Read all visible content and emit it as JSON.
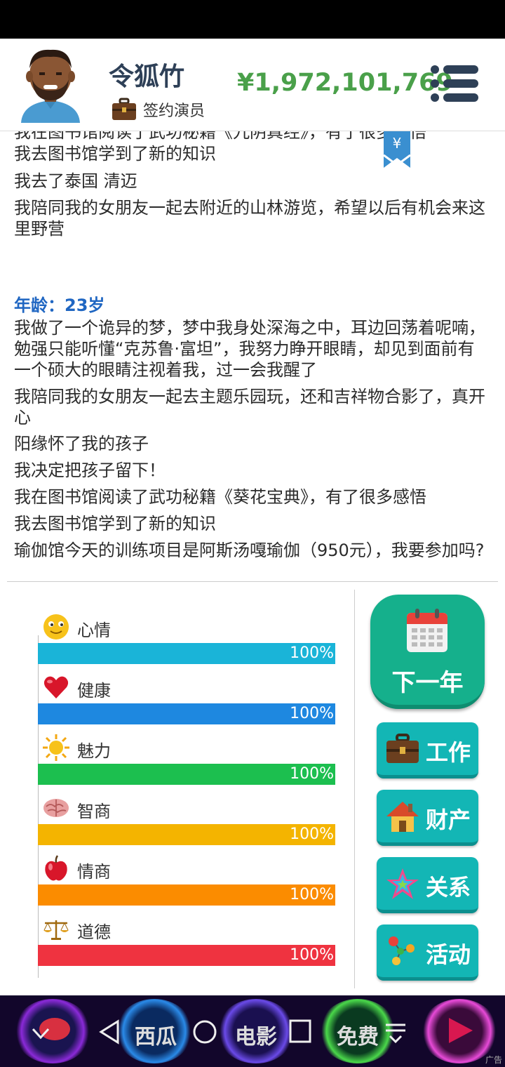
{
  "header": {
    "player_name": "令狐竹",
    "job": "签约演员",
    "money": "¥1,972,101,769"
  },
  "log": {
    "entries_before": [
      "我去图书馆学到了新的知识",
      "我去了泰国 清迈",
      "我陪同我的女朋友一起去附近的山林游览，希望以后有机会来这里野营"
    ],
    "age_heading": "年龄：23岁",
    "entries_after": [
      "我做了一个诡异的梦，梦中我身处深海之中，耳边回荡着呢喃，勉强只能听懂“克苏鲁·富坦”，我努力睁开眼睛，却见到面前有一个硕大的眼睛注视着我，过一会我醒了",
      "我陪同我的女朋友一起去主题乐园玩，还和吉祥物合影了，真开心",
      "阳缘怀了我的孩子",
      "我决定把孩子留下！",
      "我在图书馆阅读了武功秘籍《葵花宝典》，有了很多感悟",
      "我去图书馆学到了新的知识",
      "瑜伽馆今天的训练项目是阿斯汤嘎瑜伽（950元），我要参加吗?"
    ]
  },
  "stats": [
    {
      "label": "心情",
      "value": "100%",
      "fraction": 1.0,
      "color": "#1ab4d8",
      "icon": "smiley-icon"
    },
    {
      "label": "健康",
      "value": "100%",
      "fraction": 1.0,
      "color": "#1e88e0",
      "icon": "heart-icon"
    },
    {
      "label": "魅力",
      "value": "100%",
      "fraction": 1.0,
      "color": "#1cbf4f",
      "icon": "sun-icon"
    },
    {
      "label": "智商",
      "value": "100%",
      "fraction": 1.0,
      "color": "#f4b400",
      "icon": "brain-icon"
    },
    {
      "label": "情商",
      "value": "100%",
      "fraction": 1.0,
      "color": "#fb8c00",
      "icon": "apple-icon"
    },
    {
      "label": "道德",
      "value": "100%",
      "fraction": 1.0,
      "color": "#ef3340",
      "icon": "scales-icon"
    }
  ],
  "actions": {
    "next_year": "下一年",
    "work": "工作",
    "property": "财产",
    "relations": "关系",
    "activities": "活动"
  },
  "ad_bar": {
    "items": [
      "西瓜",
      "电影",
      "免费"
    ],
    "ad_label": "广告"
  }
}
